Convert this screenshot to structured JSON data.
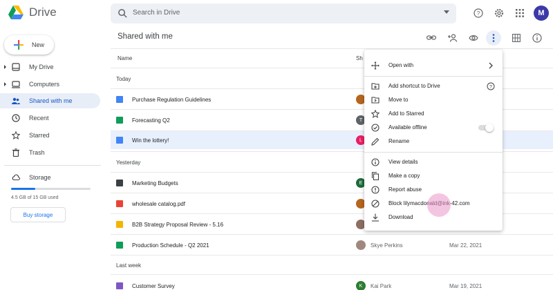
{
  "header": {
    "app_name": "Drive",
    "search_placeholder": "Search in Drive",
    "avatar_initial": "M"
  },
  "sidebar": {
    "new_label": "New",
    "items": [
      {
        "label": "My Drive",
        "icon": "my-drive-icon",
        "expandable": true
      },
      {
        "label": "Computers",
        "icon": "computer-icon",
        "expandable": true
      },
      {
        "label": "Shared with me",
        "icon": "shared-icon",
        "active": true
      },
      {
        "label": "Recent",
        "icon": "clock-icon"
      },
      {
        "label": "Starred",
        "icon": "star-icon"
      },
      {
        "label": "Trash",
        "icon": "trash-icon"
      },
      {
        "label": "Storage",
        "icon": "cloud-icon"
      }
    ],
    "storage_text": "4.5 GB of 15 GB used",
    "storage_fraction": 0.3,
    "buy_storage_label": "Buy storage"
  },
  "main": {
    "title": "Shared with me",
    "columns": {
      "name": "Name",
      "shared_by": "Sh"
    },
    "sections": {
      "today": "Today",
      "yesterday": "Yesterday",
      "last_week": "Last week"
    },
    "rows": [
      {
        "name": "Purchase Regulation Guidelines",
        "type": "doc",
        "color": "#4285f4",
        "owner_initial": "",
        "owner_color": "#b5651d",
        "owner": "",
        "date": ""
      },
      {
        "name": "Forecasting Q2",
        "type": "sheet",
        "color": "#0f9d58",
        "owner_initial": "T",
        "owner_color": "#5f6368",
        "owner": "",
        "date": ""
      },
      {
        "name": "Win the lottery!",
        "type": "doc",
        "color": "#4285f4",
        "owner_initial": "L",
        "owner_color": "#e91e63",
        "owner": "",
        "date": ""
      },
      {
        "name": "Marketing Budgets",
        "type": "folder",
        "color": "#3c4043",
        "owner_initial": "E",
        "owner_color": "#1e6b3a",
        "owner": "",
        "date": ""
      },
      {
        "name": "wholesale catalog.pdf",
        "type": "pdf",
        "color": "#ea4335",
        "owner_initial": "",
        "owner_color": "#b5651d",
        "owner": "",
        "date": ""
      },
      {
        "name": "B2B Strategy Proposal Review - 5.16",
        "type": "slides",
        "color": "#f4b400",
        "owner_initial": "",
        "owner_color": "#8d6e63",
        "owner": "",
        "date": ""
      },
      {
        "name": "Production Schedule - Q2 2021",
        "type": "sheet",
        "color": "#0f9d58",
        "owner_initial": "",
        "owner_color": "#a1887f",
        "owner": "Skye Perkins",
        "date": "Mar 22, 2021"
      },
      {
        "name": "Customer Survey",
        "type": "form",
        "color": "#7e57c2",
        "owner_initial": "K",
        "owner_color": "#2e7d32",
        "owner": "Kai Park",
        "date": "Mar 19, 2021"
      }
    ]
  },
  "context_menu": {
    "items": [
      {
        "label": "Open with",
        "icon": "move-arrows-icon",
        "submenu": true
      },
      {
        "label": "Add shortcut to Drive",
        "icon": "add-shortcut-icon",
        "help": true
      },
      {
        "label": "Move to",
        "icon": "move-folder-icon"
      },
      {
        "label": "Add to Starred",
        "icon": "star-icon"
      },
      {
        "label": "Available offline",
        "icon": "offline-icon",
        "toggle": false
      },
      {
        "label": "Rename",
        "icon": "pencil-icon"
      },
      {
        "label": "View details",
        "icon": "info-icon"
      },
      {
        "label": "Make a copy",
        "icon": "copy-icon"
      },
      {
        "label": "Report abuse",
        "icon": "report-icon"
      },
      {
        "label": "Block lilymacdonald@ink-42.com",
        "icon": "block-icon"
      },
      {
        "label": "Download",
        "icon": "download-icon"
      }
    ]
  }
}
